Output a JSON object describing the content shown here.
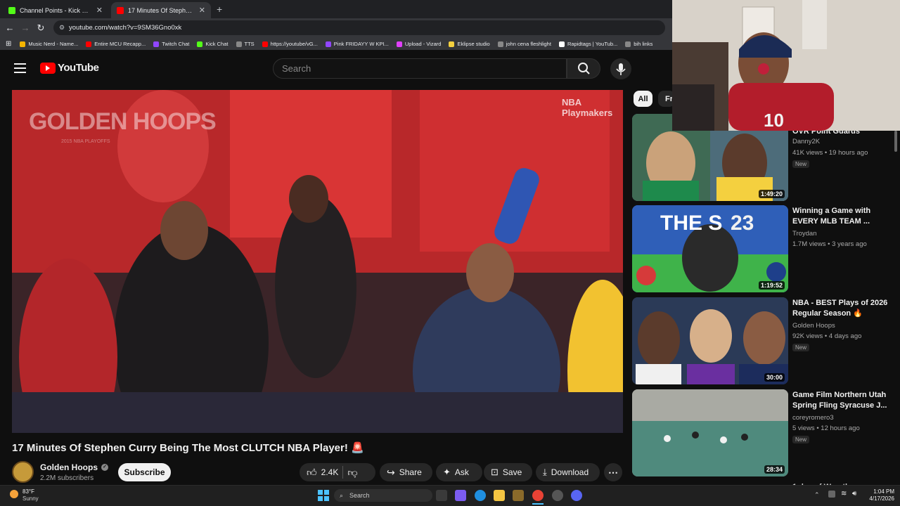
{
  "browser": {
    "tabs": [
      {
        "title": "Channel Points - Kick Dashboa",
        "color": "#53fc18",
        "active": false
      },
      {
        "title": "17 Minutes Of Stephen Curry B",
        "color": "#ff0000",
        "active": true
      }
    ],
    "new_tab": "+",
    "url": "youtube.com/watch?v=9SM36Gno0xk",
    "bookmarks": [
      {
        "label": "Music Nerd - Name...",
        "color": "#f4b400"
      },
      {
        "label": "Entire MCU Recapp...",
        "color": "#ff0000"
      },
      {
        "label": "Twitch Chat",
        "color": "#9146ff"
      },
      {
        "label": "Kick Chat",
        "color": "#53fc18"
      },
      {
        "label": "TTS",
        "color": "#888888"
      },
      {
        "label": "https://youtube/vG...",
        "color": "#ff0000"
      },
      {
        "label": "Pink FRIDAYY W KPI...",
        "color": "#9146ff"
      },
      {
        "label": "Upload - Vizard",
        "color": "#e040fb"
      },
      {
        "label": "Eklipse studio",
        "color": "#f4d03f"
      },
      {
        "label": "john cena fleshlight",
        "color": "#888888"
      },
      {
        "label": "Rapidtags | YouTub...",
        "color": "#ffffff"
      },
      {
        "label": "bih links",
        "color": "#888888"
      }
    ]
  },
  "youtube": {
    "logo_text": "YouTube",
    "search_placeholder": "Search",
    "watermark_title": "GOLDEN HOOPS",
    "watermark_sub": "2015 NBA PLAYOFFS",
    "corner_logo": "NBA Playmakers",
    "video": {
      "title": "17 Minutes Of Stephen Curry Being The Most CLUTCH NBA Player! 🚨",
      "channel": "Golden Hoops",
      "subscribers": "2.2M subscribers",
      "subscribe_label": "Subscribe",
      "likes": "2.4K",
      "share_label": "Share",
      "ask_label": "Ask",
      "save_label": "Save",
      "download_label": "Download"
    },
    "chips": [
      "All",
      "Fr"
    ],
    "recommendations": [
      {
        "title": "OVR Point Guards",
        "channel": "Danny2K",
        "meta": "41K views • 19 hours ago",
        "badge": "New",
        "duration": "1:49:20",
        "bg": "#5a7d8f"
      },
      {
        "title": "Winning a Game with EVERY MLB TEAM ...",
        "channel": "Troydan",
        "meta": "1.7M views • 3 years ago",
        "badge": "",
        "duration": "1:19:52",
        "bg": "#3a6bc4"
      },
      {
        "title": "NBA - BEST Plays of 2026 Regular Season 🔥",
        "channel": "Golden Hoops",
        "meta": "92K views • 4 days ago",
        "badge": "New",
        "duration": "30:00",
        "bg": "#2d3b5a"
      },
      {
        "title": "Game Film Northern Utah Spring Fling Syracuse J...",
        "channel": "coreyromero3",
        "meta": "5 views • 12 hours ago",
        "badge": "New",
        "duration": "28:34",
        "bg": "#8a8f87"
      }
    ],
    "next_partial": "1 day of Wrestl..."
  },
  "taskbar": {
    "weather_temp": "83°F",
    "weather_desc": "Sunny",
    "search_label": "Search",
    "time": "1:04 PM",
    "date": "4/17/2026"
  }
}
